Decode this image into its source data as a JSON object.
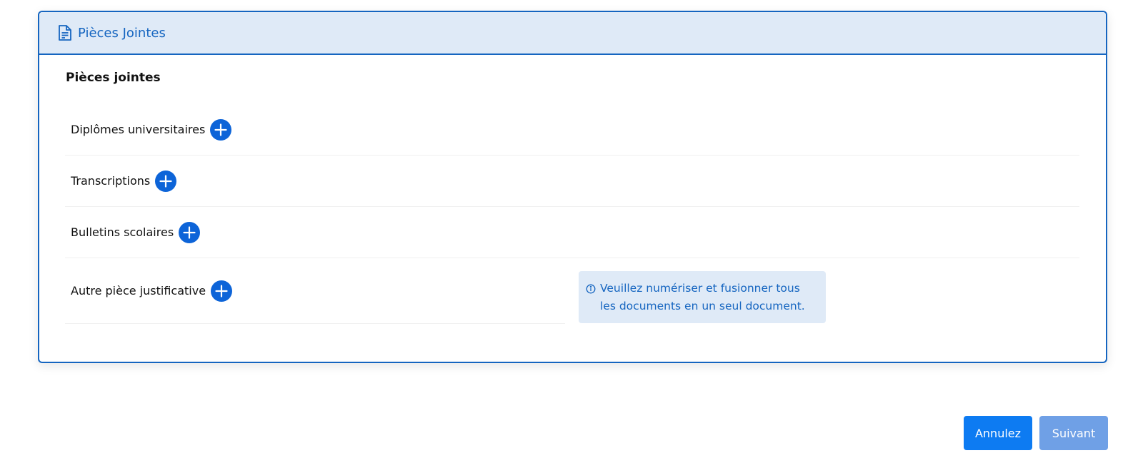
{
  "panel": {
    "title": "Pièces Jointes",
    "title_icon": "document-icon",
    "section_title": "Pièces jointes",
    "attachments": [
      {
        "label": "Diplômes universitaires",
        "action_icon": "plus-circle-icon"
      },
      {
        "label": "Transcriptions",
        "action_icon": "plus-circle-icon"
      },
      {
        "label": "Bulletins scolaires",
        "action_icon": "plus-circle-icon"
      },
      {
        "label": "Autre pièce justificative",
        "action_icon": "plus-circle-icon"
      }
    ],
    "info": {
      "icon": "info-icon",
      "text": "Veuillez numériser et fusionner tous les documents en un seul document."
    }
  },
  "footer": {
    "cancel_label": "Annulez",
    "next_label": "Suivant"
  },
  "colors": {
    "accent": "#1565c0",
    "header_bg": "#dfeaf7",
    "primary_button": "#0d7bf2",
    "disabled_button": "#6fa0e6"
  }
}
